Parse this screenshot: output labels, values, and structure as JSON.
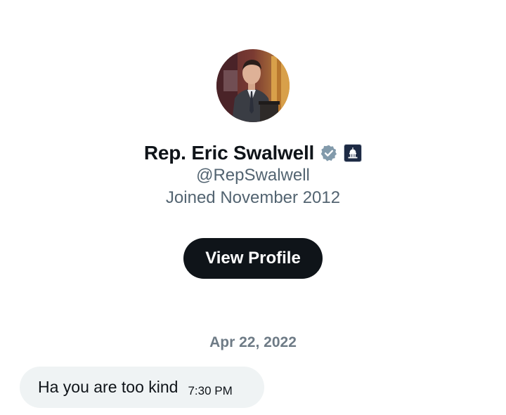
{
  "profile": {
    "avatar_alt": "profile photo",
    "display_name": "Rep. Eric Swalwell",
    "verified_icon": "verified-badge-icon",
    "affiliation_icon": "capitol-government-icon",
    "handle": "@RepSwalwell",
    "joined": "Joined November 2012",
    "view_profile_label": "View Profile"
  },
  "conversation": {
    "date": "Apr 22, 2022",
    "messages": [
      {
        "text": "Ha you are too kind",
        "time": "7:30 PM"
      }
    ]
  },
  "colors": {
    "primary_text": "#0f1419",
    "secondary_text": "#536471",
    "button_bg": "#0f1419",
    "bubble_bg": "#eff3f4",
    "verified_badge": "#829aab",
    "gov_badge": "#1d2a44"
  }
}
